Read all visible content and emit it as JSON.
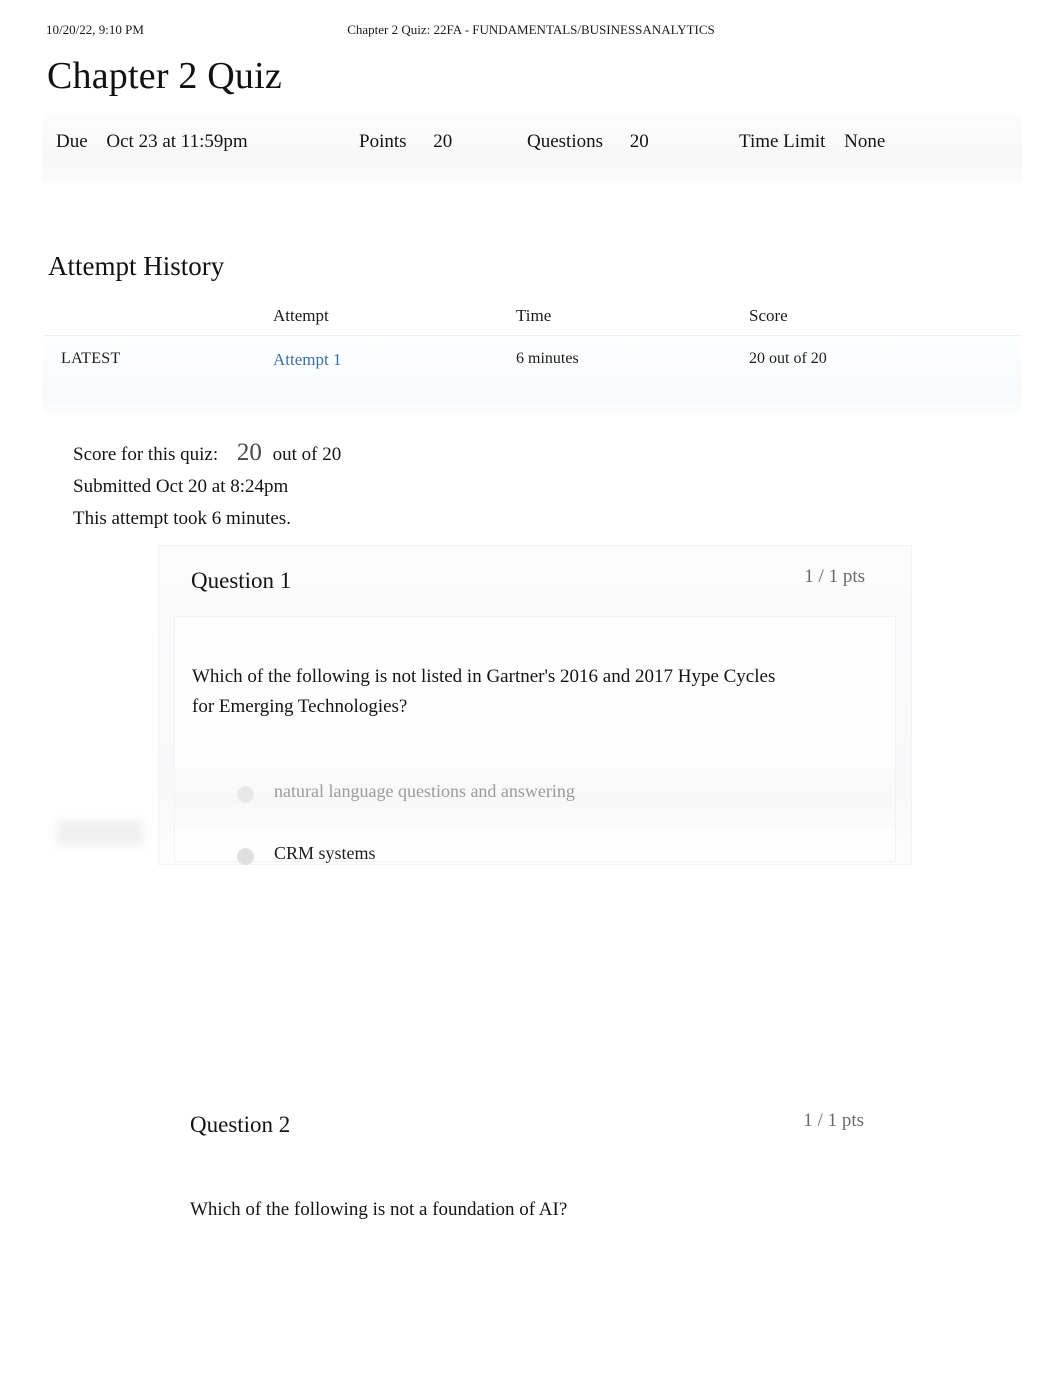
{
  "print_header": {
    "date": "10/20/22, 9:10 PM",
    "title": "Chapter 2 Quiz: 22FA - FUNDAMENTALS/BUSINESSANALYTICS"
  },
  "page_title": "Chapter 2 Quiz",
  "quiz_meta": {
    "due_label": "Due",
    "due_value": "Oct 23 at 11:59pm",
    "points_label": "Points",
    "points_value": "20",
    "questions_label": "Questions",
    "questions_value": "20",
    "time_limit_label": "Time Limit",
    "time_limit_value": "None"
  },
  "attempt_history": {
    "section_title": "Attempt History",
    "columns": [
      "",
      "Attempt",
      "Time",
      "Score"
    ],
    "rows": [
      {
        "flag": "LATEST",
        "attempt": "Attempt 1",
        "time": "6 minutes",
        "score": "20 out of 20"
      }
    ]
  },
  "score_summary": {
    "score_label": "Score for this quiz:",
    "score_value": "20",
    "out_of": "out of 20",
    "submitted": "Submitted Oct 20 at 8:24pm",
    "duration": "This attempt took 6 minutes."
  },
  "questions": [
    {
      "number": "Question 1",
      "points": "1 / 1 pts",
      "text": "Which of the following is not listed in Gartner's 2016 and 2017 Hype Cycles for Emerging Technologies?",
      "answers": [
        {
          "label": "natural language questions and answering",
          "state": "faded"
        },
        {
          "label": "CRM systems",
          "state": "normal"
        }
      ]
    },
    {
      "number": "Question 2",
      "points": "1 / 1 pts",
      "text": "Which of the following is not a foundation of AI?",
      "answers": []
    }
  ],
  "colors": {
    "link": "#3b73a8",
    "text": "#141414",
    "muted": "#6a6a6a",
    "faded_answer": "#9b9b9b",
    "band": "#f8f8f9"
  }
}
